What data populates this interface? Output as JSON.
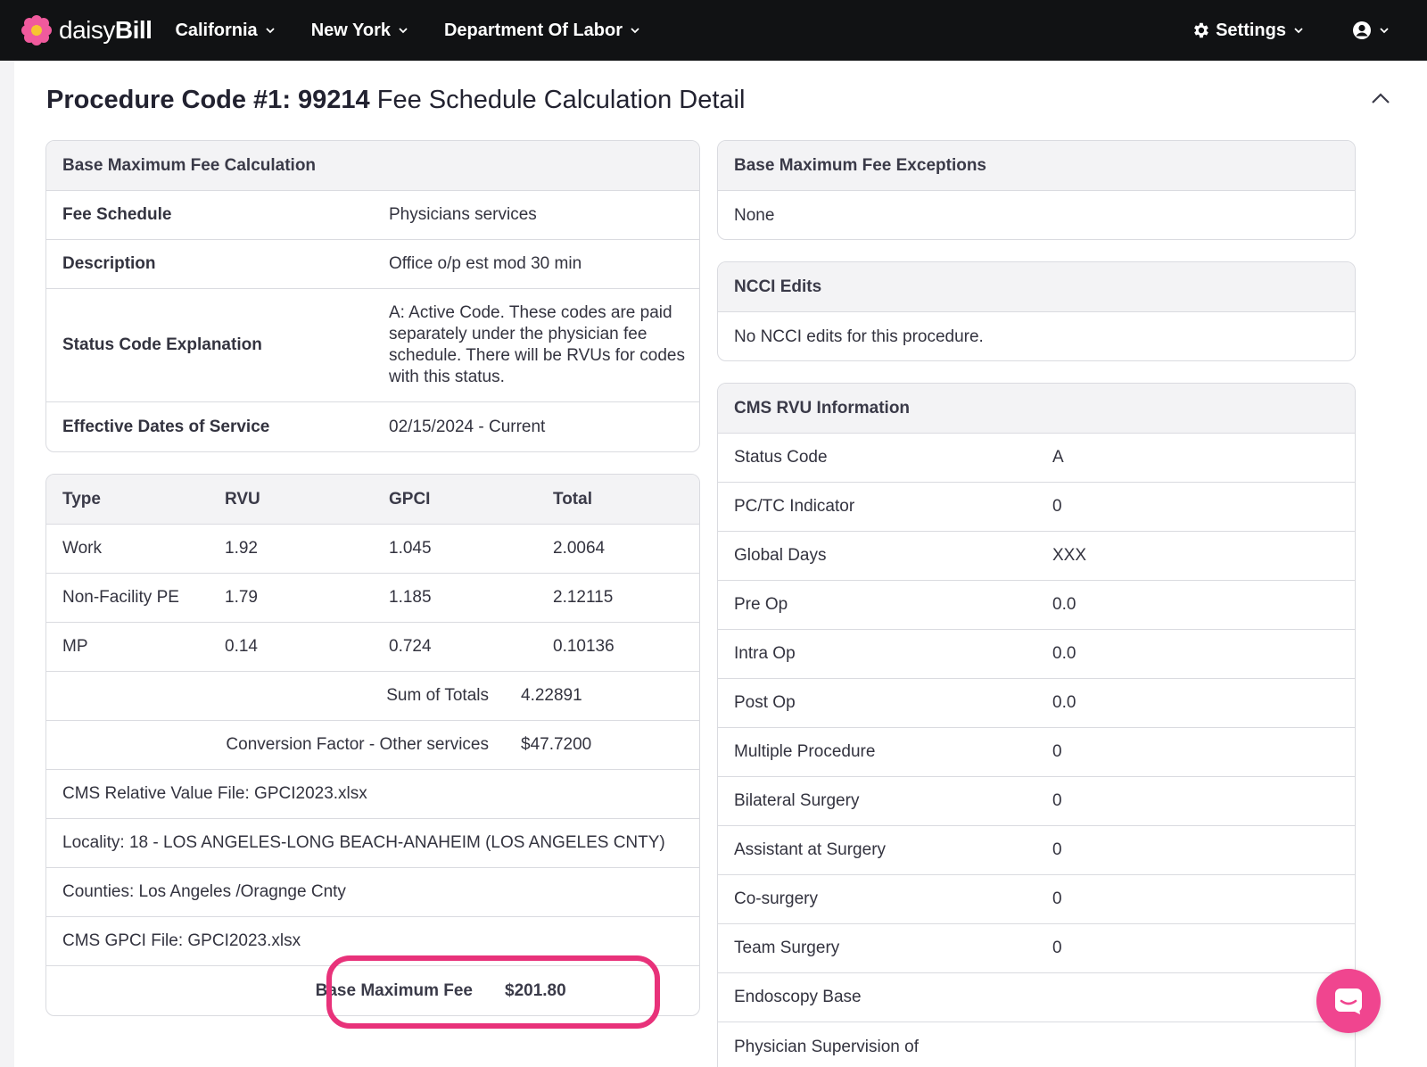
{
  "nav": {
    "brand_light": "daisy",
    "brand_bold": "Bill",
    "items": [
      "California",
      "New York",
      "Department Of Labor"
    ],
    "settings_label": "Settings"
  },
  "title": {
    "bold": "Procedure Code #1: 99214",
    "rest": " Fee Schedule Calculation Detail"
  },
  "base_calc": {
    "heading": "Base Maximum Fee Calculation",
    "rows": [
      {
        "label": "Fee Schedule",
        "value": "Physicians services"
      },
      {
        "label": "Description",
        "value": "Office o/p est mod 30 min"
      },
      {
        "label": "Status Code Explanation",
        "value": "A: Active Code. These codes are paid separately under the physician fee schedule. There will be RVUs for codes with this status."
      },
      {
        "label": "Effective Dates of Service",
        "value": "02/15/2024 - Current"
      }
    ]
  },
  "rvu_table": {
    "headers": [
      "Type",
      "RVU",
      "GPCI",
      "Total"
    ],
    "rows": [
      [
        "Work",
        "1.92",
        "1.045",
        "2.0064"
      ],
      [
        "Non-Facility PE",
        "1.79",
        "1.185",
        "2.12115"
      ],
      [
        "MP",
        "0.14",
        "0.724",
        "0.10136"
      ]
    ],
    "sum_label": "Sum of Totals",
    "sum_value": "4.22891",
    "cf_label": "Conversion Factor - Other services",
    "cf_value": "$47.7200",
    "notes": [
      "CMS Relative Value File: GPCI2023.xlsx",
      "Locality: 18 - LOS ANGELES-LONG BEACH-ANAHEIM (LOS ANGELES CNTY)",
      "Counties: Los Angeles /Oragnge Cnty",
      "CMS GPCI File: GPCI2023.xlsx"
    ],
    "fee_label": "Base Maximum Fee",
    "fee_value": "$201.80"
  },
  "exceptions": {
    "heading": "Base Maximum Fee Exceptions",
    "value": "None"
  },
  "ncci": {
    "heading": "NCCI Edits",
    "value": "No NCCI edits for this procedure."
  },
  "cms": {
    "heading": "CMS RVU Information",
    "rows": [
      {
        "label": "Status Code",
        "value": "A"
      },
      {
        "label": "PC/TC Indicator",
        "value": "0"
      },
      {
        "label": "Global Days",
        "value": "XXX"
      },
      {
        "label": "Pre Op",
        "value": "0.0"
      },
      {
        "label": "Intra Op",
        "value": "0.0"
      },
      {
        "label": "Post Op",
        "value": "0.0"
      },
      {
        "label": "Multiple Procedure",
        "value": "0"
      },
      {
        "label": "Bilateral Surgery",
        "value": "0"
      },
      {
        "label": "Assistant at Surgery",
        "value": "0"
      },
      {
        "label": "Co-surgery",
        "value": "0"
      },
      {
        "label": "Team Surgery",
        "value": "0"
      },
      {
        "label": "Endoscopy Base",
        "value": ""
      },
      {
        "label": "Physician Supervision of",
        "value": ""
      }
    ]
  },
  "colors": {
    "nav_bg": "#111214",
    "highlight": "#e8327a",
    "chat": "#f0458f"
  }
}
